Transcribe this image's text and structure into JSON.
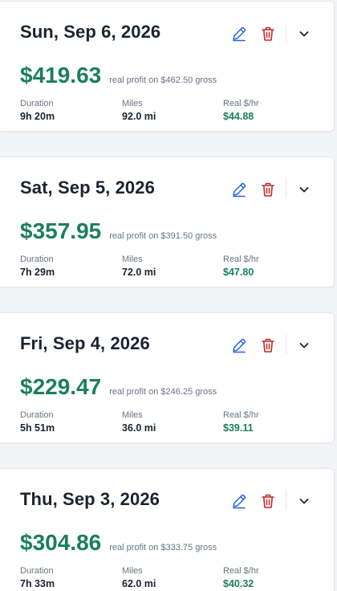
{
  "colors": {
    "profit_green": "#1b7f5c",
    "edit_blue": "#2563eb",
    "delete_red": "#c62828",
    "text_dark": "#1d2230",
    "text_muted": "#6b7280"
  },
  "icons": {
    "edit": "pencil-icon",
    "delete": "trash-icon",
    "expand": "chevron-down-icon"
  },
  "labels": {
    "duration": "Duration",
    "miles": "Miles",
    "rate": "Real $/hr"
  },
  "shifts": [
    {
      "date": "Sun, Sep 6, 2026",
      "profit": "$419.63",
      "profit_note": "real profit on $462.50 gross",
      "duration": "9h 20m",
      "miles": "92.0 mi",
      "rate": "$44.88"
    },
    {
      "date": "Sat, Sep 5, 2026",
      "profit": "$357.95",
      "profit_note": "real profit on $391.50 gross",
      "duration": "7h 29m",
      "miles": "72.0 mi",
      "rate": "$47.80"
    },
    {
      "date": "Fri, Sep 4, 2026",
      "profit": "$229.47",
      "profit_note": "real profit on $246.25 gross",
      "duration": "5h 51m",
      "miles": "36.0 mi",
      "rate": "$39.11"
    },
    {
      "date": "Thu, Sep 3, 2026",
      "profit": "$304.86",
      "profit_note": "real profit on $333.75 gross",
      "duration": "7h 33m",
      "miles": "62.0 mi",
      "rate": "$40.32"
    }
  ]
}
